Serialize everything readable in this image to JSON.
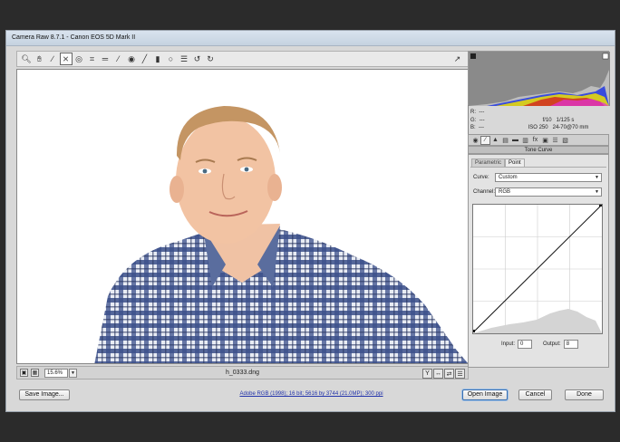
{
  "window": {
    "title": "Camera Raw 8.7.1  -  Canon EOS 5D Mark II"
  },
  "toolbar": {
    "tools": [
      "zoom-icon",
      "hand-icon",
      "white-balance-icon",
      "color-sampler-icon",
      "targeted-adjustment-icon",
      "crop-icon",
      "straighten-icon",
      "spot-removal-icon",
      "red-eye-icon",
      "adjustment-brush-icon",
      "graduated-filter-icon",
      "radial-filter-icon",
      "preferences-icon",
      "rotate-ccw-icon",
      "rotate-cw-icon"
    ],
    "active_tool": "color-sampler-icon"
  },
  "status": {
    "zoom": "15.6%",
    "filename": "h_0333.dng"
  },
  "readout": {
    "r_label": "R:",
    "g_label": "G:",
    "b_label": "B:",
    "r_value": "---",
    "g_value": "---",
    "b_value": "---",
    "aperture": "f/10",
    "shutter": "1/125 s",
    "iso": "ISO 250",
    "lens": "24-70@70 mm"
  },
  "panel": {
    "title": "Tone Curve",
    "subtabs": [
      "Parametric",
      "Point"
    ],
    "active_subtab": "Point",
    "curve_label": "Curve:",
    "curve_value": "Custom",
    "channel_label": "Channel:",
    "channel_value": "RGB",
    "input_label": "Input:",
    "input_value": "0",
    "output_label": "Output:",
    "output_value": "8"
  },
  "footer": {
    "save_label": "Save Image...",
    "workflow_link": "Adobe RGB (1998); 16 bit; 5616 by 3744 (21.0MP); 300 ppi",
    "open_label": "Open Image",
    "cancel_label": "Cancel",
    "done_label": "Done"
  },
  "colors": {
    "accent": "#3a6fb0",
    "link": "#2233aa"
  }
}
